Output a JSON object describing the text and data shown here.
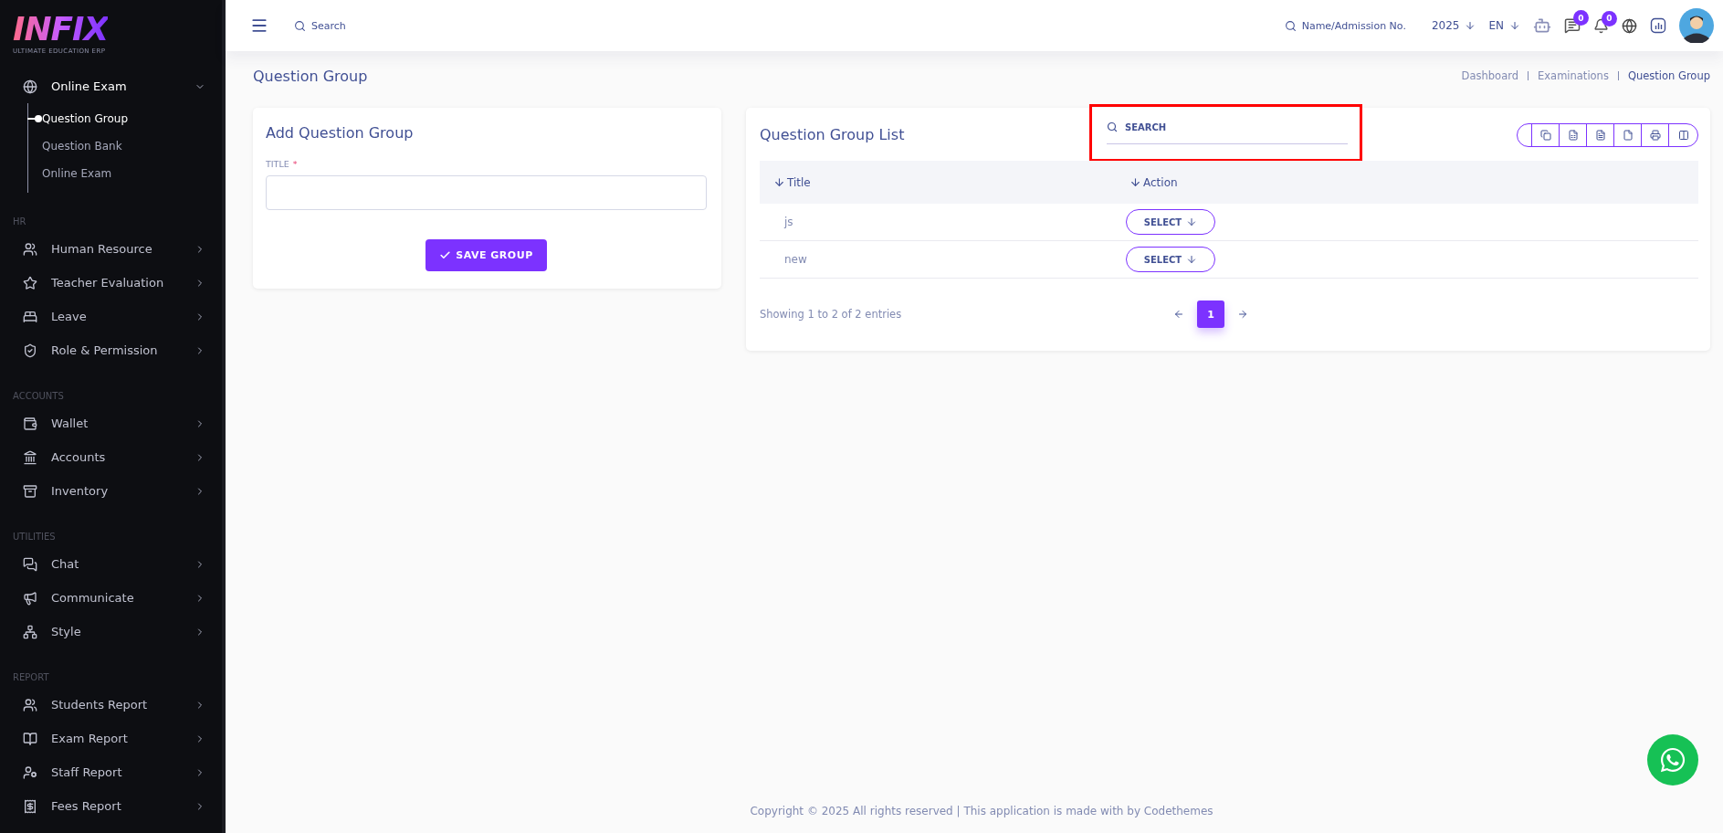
{
  "logo": {
    "name": "INFIX",
    "tagline": "ULTIMATE EDUCATION ERP"
  },
  "sidebar": {
    "sections": [
      {
        "items": [
          {
            "label": "Online Exam",
            "expanded": true,
            "children": [
              {
                "label": "Question Group",
                "selected": true
              },
              {
                "label": "Question Bank",
                "selected": false
              },
              {
                "label": "Online Exam",
                "selected": false
              }
            ]
          }
        ]
      },
      {
        "heading": "HR",
        "items": [
          {
            "label": "Human Resource",
            "expanded": false
          },
          {
            "label": "Teacher Evaluation",
            "expanded": false
          },
          {
            "label": "Leave",
            "expanded": false
          },
          {
            "label": "Role & Permission",
            "expanded": false
          }
        ]
      },
      {
        "heading": "ACCOUNTS",
        "items": [
          {
            "label": "Wallet",
            "expanded": false
          },
          {
            "label": "Accounts",
            "expanded": false
          },
          {
            "label": "Inventory",
            "expanded": false
          }
        ]
      },
      {
        "heading": "UTILITIES",
        "items": [
          {
            "label": "Chat",
            "expanded": false
          },
          {
            "label": "Communicate",
            "expanded": false
          },
          {
            "label": "Style",
            "expanded": false
          }
        ]
      },
      {
        "heading": "REPORT",
        "items": [
          {
            "label": "Students Report",
            "expanded": false
          },
          {
            "label": "Exam Report",
            "expanded": false
          },
          {
            "label": "Staff Report",
            "expanded": false
          },
          {
            "label": "Fees Report",
            "expanded": false
          }
        ]
      }
    ]
  },
  "topbar": {
    "search_placeholder": "Search",
    "student_search_placeholder": "Name/Admission No.",
    "year": "2025",
    "language": "EN",
    "chat_count": "0",
    "notification_count": "0"
  },
  "page": {
    "title": "Question Group",
    "breadcrumbs": [
      {
        "label": "Dashboard",
        "selected": false
      },
      {
        "label": "Examinations",
        "selected": false
      },
      {
        "label": "Question Group",
        "selected": true
      }
    ]
  },
  "form": {
    "title": "Add Question Group",
    "field": {
      "label": "TITLE",
      "required_mark": "*"
    },
    "submit": "SAVE GROUP"
  },
  "list": {
    "title": "Question Group List",
    "search_placeholder": "SEARCH",
    "columns": [
      "Title",
      "Action"
    ],
    "rows": [
      {
        "title": "js",
        "action": "SELECT"
      },
      {
        "title": "new",
        "action": "SELECT"
      }
    ],
    "info": "Showing 1 to 2 of 2 entries",
    "pages": [
      {
        "label": "1",
        "selected": true
      }
    ]
  },
  "footer": "Copyright © 2025 All rights reserved | This application is made with by Codethemes"
}
